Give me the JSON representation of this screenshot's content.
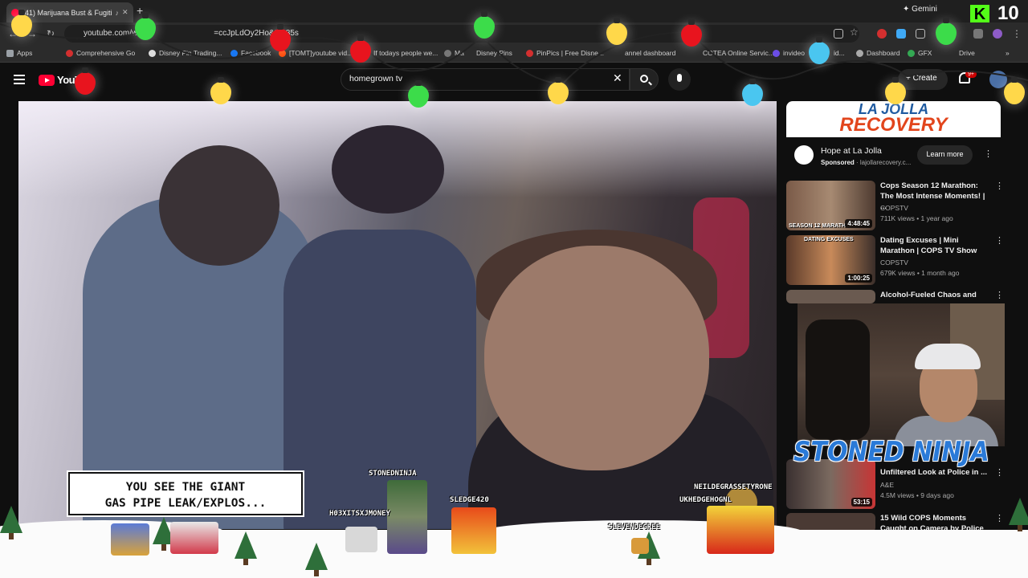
{
  "browser": {
    "tab_title": "(41) Marijuana Bust & Fugiti",
    "new_tab": "+",
    "gemini_label": "Gemini",
    "url": "youtube.com/w",
    "url_tail": "=ccJpLdOy2Ho&t=885s",
    "bookmarks": [
      "Apps",
      "Comprehensive Go",
      "Disney Pin Trading...",
      "Facebook",
      "[TOMT]youtube vid...",
      "If todays people we...",
      "Ma",
      "Disney Pins",
      "PinPics | Free Disne...",
      "annel dashboard",
      "COTEA Online Servic...",
      "invideo",
      "id...",
      "Dashboard",
      "GFX",
      "Drive"
    ]
  },
  "youtube": {
    "logo_text": "YouT",
    "search_value": "homegrown tv",
    "create_label": "Create",
    "notif_count": "9+"
  },
  "ad": {
    "banner_line1": "LA JOLLA",
    "banner_line2": "RECOVERY",
    "title": "Hope at La Jolla",
    "sponsored": "Sponsored",
    "domain": "lajollarecovery.c...",
    "cta": "Learn more"
  },
  "recommendations": [
    {
      "title": "Cops Season 12 Marathon: The Most Intense Moments! | ...",
      "channel": "COPSTV",
      "meta": "711K views • 1 year ago",
      "duration": "4:48:45",
      "thumb_label": "SEASON 12 MARATH"
    },
    {
      "title": "Dating Excuses | Mini Marathon | COPS TV Show",
      "channel": "COPSTV",
      "meta": "679K views • 1 month ago",
      "duration": "1:00:25",
      "thumb_label": "DATING EXCUSES"
    },
    {
      "title": "Alcohol-Fueled Chaos and",
      "channel": "",
      "meta": "",
      "duration": "",
      "thumb_label": ""
    },
    {
      "title": "Unfiltered Look at Police in ...",
      "channel": "A&E",
      "meta": "4.5M views • 9 days ago",
      "duration": "53:15",
      "thumb_label": ""
    },
    {
      "title": "15 Wild COPS Moments Caught on Camera by Police",
      "channel": "",
      "meta": "",
      "duration": "",
      "thumb_label": ""
    }
  ],
  "overlay": {
    "streamer_name": "STONED NINJA",
    "subtitle_line1": "YOU SEE THE GIANT",
    "subtitle_line2": "GAS PIPE LEAK/EXPLOS...",
    "chat_users": [
      "STONEDNINJA",
      "H03XITSXJMONEY",
      "SLEDGE420",
      "SLEVENDEGREE",
      "NEILDEGRASSETYRONE",
      "UKHEDGEHOGNL"
    ],
    "kick_logo": "K",
    "kick_count": "10"
  },
  "colors": {
    "yt_red": "#ff0033",
    "ninja_blue": "#2a7ad8",
    "kick_green": "#53fc18"
  }
}
